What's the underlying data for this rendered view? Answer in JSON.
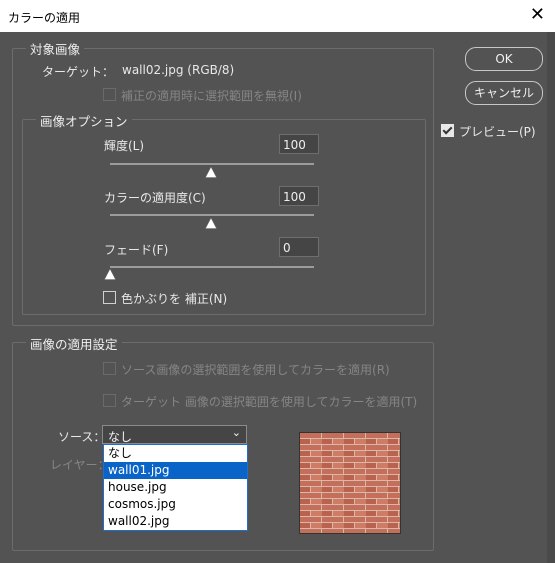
{
  "window": {
    "title": "カラーの適用",
    "close_glyph": "✕"
  },
  "buttons": {
    "ok": "OK",
    "cancel": "キャンセル"
  },
  "preview_toggle": {
    "label": "プレビュー(P)",
    "checked": true
  },
  "target_group": {
    "title": "対象画像",
    "target_label": "ターゲット：",
    "target_value": "wall02.jpg (RGB/8)",
    "ignore_selection": "補正の適用時に選択範囲を無視(I)"
  },
  "image_options": {
    "title": "画像オプション",
    "luminance": {
      "label": "輝度(L)",
      "value": "100",
      "level": 0.5
    },
    "color_intensity": {
      "label": "カラーの適用度(C)",
      "value": "100",
      "level": 0.5
    },
    "fade": {
      "label": "フェード(F)",
      "value": "0",
      "level": 0.0
    },
    "neutralize": "色かぶりを 補正(N)"
  },
  "stats_group": {
    "title": "画像の適用設定",
    "use_source_selection": "ソース画像の選択範囲を使用してカラーを適用(R)",
    "use_target_selection": "ターゲット 画像の選択範囲を使用してカラーを適用(T)",
    "source_label": "ソース：",
    "source_value": "なし",
    "layer_label": "レイヤー：",
    "source_options": [
      "なし",
      "wall01.jpg",
      "house.jpg",
      "cosmos.jpg",
      "wall02.jpg"
    ],
    "highlighted_option": "wall01.jpg"
  },
  "colors": {
    "background": "#535353",
    "highlight": "#0a64c8",
    "brick": "#c8735f"
  }
}
